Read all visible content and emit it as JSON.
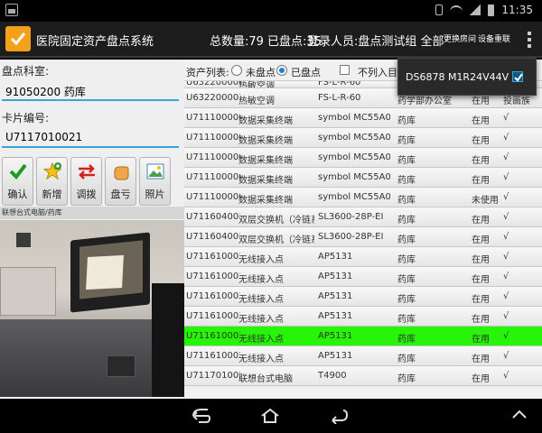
{
  "status_bar": {
    "time": "11:35"
  },
  "app_bar": {
    "title": "医院固定资产盘点系统",
    "count_text": "总数量:79 已盘点:35",
    "user_text": "登录人员:盘点测试组 全部",
    "btn_switch_room": "更换房间",
    "btn_reconnect": "设备重联"
  },
  "left_panel": {
    "room_label": "盘点科室:",
    "room_value": "91050200 药库",
    "card_label": "卡片编号:",
    "card_value": "U7117010021",
    "tools": [
      {
        "icon": "check-icon",
        "label": "确认"
      },
      {
        "icon": "star-add-icon",
        "label": "新增"
      },
      {
        "icon": "transfer-arrows-icon",
        "label": "调拨"
      },
      {
        "icon": "hand-icon",
        "label": "盘亏"
      },
      {
        "icon": "picture-icon",
        "label": "照片"
      }
    ],
    "photo_caption": "联想台式电脑/药库"
  },
  "list_header": {
    "label": "资产列表:",
    "option_unchecked": "未盘点",
    "option_checked": "已盘点",
    "exclude_label": "不列入目录"
  },
  "popup": {
    "device": "DS6878 M1R24V44V"
  },
  "colors": {
    "highlight": "#27f507",
    "accent": "#35a7d6",
    "logo": "#f3a01b"
  },
  "rows": [
    {
      "code": "U6322000009",
      "name": "热敏空调",
      "model": "FS-L-R-60",
      "dept": "",
      "status": "",
      "check": "",
      "highlight": false,
      "partial": true
    },
    {
      "code": "U6322000010",
      "name": "热敏空调",
      "model": "FS-L-R-60",
      "dept": "药学部办公室",
      "status": "在用",
      "check": "投画族",
      "highlight": false,
      "partial": false
    },
    {
      "code": "U7111000005",
      "name": "数据采集终端",
      "model": "symbol MC55A0",
      "dept": "药库",
      "status": "在用",
      "check": "√",
      "highlight": false,
      "partial": false
    },
    {
      "code": "U7111000006",
      "name": "数据采集终端",
      "model": "symbol MC55A0",
      "dept": "药库",
      "status": "在用",
      "check": "√",
      "highlight": false,
      "partial": false
    },
    {
      "code": "U7111000007",
      "name": "数据采集终端",
      "model": "symbol MC55A0",
      "dept": "药库",
      "status": "在用",
      "check": "√",
      "highlight": false,
      "partial": false
    },
    {
      "code": "U7111000008",
      "name": "数据采集终端",
      "model": "symbol MC55A0",
      "dept": "药库",
      "status": "在用",
      "check": "√",
      "highlight": false,
      "partial": false
    },
    {
      "code": "U7111000009",
      "name": "数据采集终端",
      "model": "symbol MC55A0",
      "dept": "药库",
      "status": "未使用",
      "check": "√",
      "highlight": false,
      "partial": false
    },
    {
      "code": "U7116040016",
      "name": "双层交换机（冷链系",
      "model": "SL3600-28P-EI",
      "dept": "药库",
      "status": "在用",
      "check": "√",
      "highlight": false,
      "partial": false
    },
    {
      "code": "U7116040017",
      "name": "双层交换机（冷链系",
      "model": "SL3600-28P-EI",
      "dept": "药库",
      "status": "在用",
      "check": "√",
      "highlight": false,
      "partial": false
    },
    {
      "code": "U7116100015",
      "name": "无线接入点",
      "model": "AP5131",
      "dept": "药库",
      "status": "在用",
      "check": "√",
      "highlight": false,
      "partial": false
    },
    {
      "code": "U7116100016",
      "name": "无线接入点",
      "model": "AP5131",
      "dept": "药库",
      "status": "在用",
      "check": "√",
      "highlight": false,
      "partial": false
    },
    {
      "code": "U7116100017",
      "name": "无线接入点",
      "model": "AP5131",
      "dept": "药库",
      "status": "在用",
      "check": "√",
      "highlight": false,
      "partial": false
    },
    {
      "code": "U7116100018",
      "name": "无线接入点",
      "model": "AP5131",
      "dept": "药库",
      "status": "在用",
      "check": "√",
      "highlight": false,
      "partial": false
    },
    {
      "code": "U7116100019",
      "name": "无线接入点",
      "model": "AP5131",
      "dept": "药库",
      "status": "在用",
      "check": "√",
      "highlight": true,
      "partial": false
    },
    {
      "code": "U7116100020",
      "name": "无线接入点",
      "model": "AP5131",
      "dept": "药库",
      "status": "在用",
      "check": "√",
      "highlight": false,
      "partial": false
    },
    {
      "code": "U7117010021",
      "name": "联想台式电脑",
      "model": "T4900",
      "dept": "药库",
      "status": "在用",
      "check": "√",
      "highlight": false,
      "partial": false
    }
  ],
  "nav_bar": {
    "items": [
      "back-icon",
      "home-icon",
      "recent-apps-icon",
      "up-chevron-icon"
    ]
  }
}
